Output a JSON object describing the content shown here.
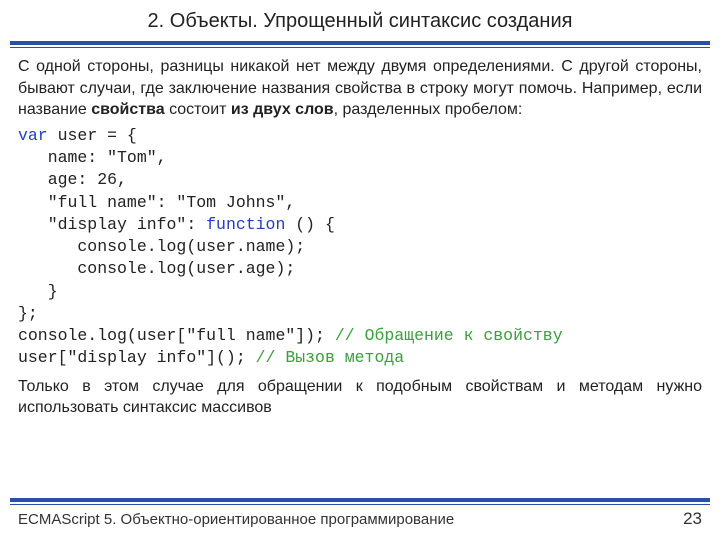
{
  "title": "2. Объекты. Упрощенный синтаксис создания",
  "para1_a": "С одной стороны, разницы никакой нет между двумя определениями. С другой стороны, бывают случаи, где заключение названия свойства в строку могут помочь. Например, если название ",
  "para1_b": "свойства",
  "para1_c": " состоит ",
  "para1_d": "из двух слов",
  "para1_e": ", разделенных пробелом:",
  "code": {
    "l1a": "var",
    "l1b": " user = {",
    "l2": "   name: \"Tom\",",
    "l3": "   age: 26,",
    "l4": "   \"full name\": \"Tom Johns\",",
    "l5a": "   \"display info\": ",
    "l5b": "function",
    "l5c": " () {",
    "l6": "      console.log(user.name);",
    "l7": "      console.log(user.age);",
    "l8": "   }",
    "l9": "};",
    "l10a": "console.log(user[\"full name\"]); ",
    "l10b": "// Обращение к свойству",
    "l11a": "user[\"display info\"](); ",
    "l11b": "// Вызов метода"
  },
  "para2": "Только в этом случае для обращении к подобным свойствам и методам нужно использовать синтаксис массивов",
  "footer_text": "ECMAScript 5. Объектно-ориентированное программирование",
  "page_num": "23"
}
